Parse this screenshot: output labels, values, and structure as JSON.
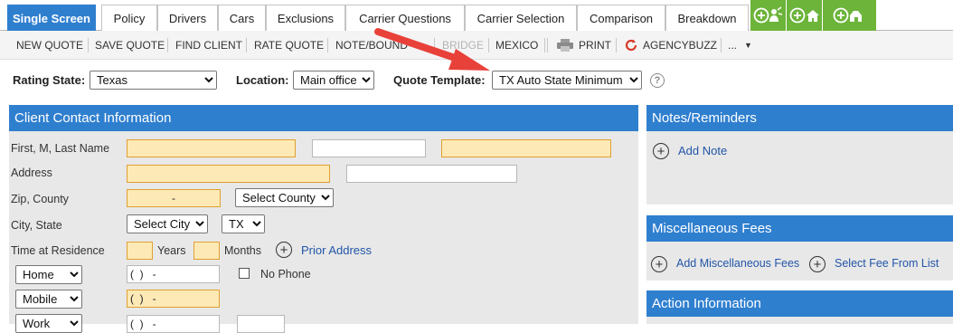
{
  "tabs": [
    {
      "label": "Single Screen",
      "active": true
    },
    {
      "label": "Policy"
    },
    {
      "label": "Drivers"
    },
    {
      "label": "Cars"
    },
    {
      "label": "Exclusions"
    },
    {
      "label": "Carrier Questions"
    },
    {
      "label": "Carrier Selection"
    },
    {
      "label": "Comparison"
    },
    {
      "label": "Breakdown"
    }
  ],
  "green_tabs": [
    {
      "icon": "add-client-icon"
    },
    {
      "icon": "add-home-icon"
    },
    {
      "icon": "add-farm-icon"
    }
  ],
  "toolbar": {
    "new_quote": "NEW QUOTE",
    "save_quote": "SAVE QUOTE",
    "find_client": "FIND CLIENT",
    "rate_quote": "RATE QUOTE",
    "note_bound": "NOTE/BOUND",
    "bridge": "BRIDGE",
    "mexico": "MEXICO",
    "print": "PRINT",
    "agencybuzz": "AGENCYBUZZ",
    "more": "..."
  },
  "rating": {
    "state_label": "Rating State:",
    "state_value": "Texas",
    "location_label": "Location:",
    "location_value": "Main office",
    "template_label": "Quote Template:",
    "template_value": "TX Auto State Minimum"
  },
  "client": {
    "title": "Client Contact Information",
    "name_label": "First, M, Last Name",
    "address_label": "Address",
    "zip_label": "Zip, County",
    "zip_value": "-",
    "county_placeholder": "Select County",
    "city_label": "City, State",
    "city_placeholder": "Select City",
    "state_value": "TX",
    "residence_label": "Time at Residence",
    "years_label": "Years",
    "months_label": "Months",
    "prior_address": "Prior Address",
    "phones": [
      {
        "type": "Home",
        "value": "(  )   -"
      },
      {
        "type": "Mobile",
        "value": "(  )   -"
      },
      {
        "type": "Work",
        "value": "(  )   -"
      }
    ],
    "no_phone_label": "No Phone"
  },
  "notes": {
    "title": "Notes/Reminders",
    "add_note": "Add Note"
  },
  "fees": {
    "title": "Miscellaneous Fees",
    "add_fees": "Add Miscellaneous Fees",
    "select_fee": "Select Fee From List"
  },
  "action": {
    "title": "Action Information"
  },
  "colors": {
    "accent_blue": "#2f7fcf",
    "green_tab": "#6cb43a",
    "required_fill": "#fde9b6",
    "annotation_arrow": "#e8413a"
  }
}
